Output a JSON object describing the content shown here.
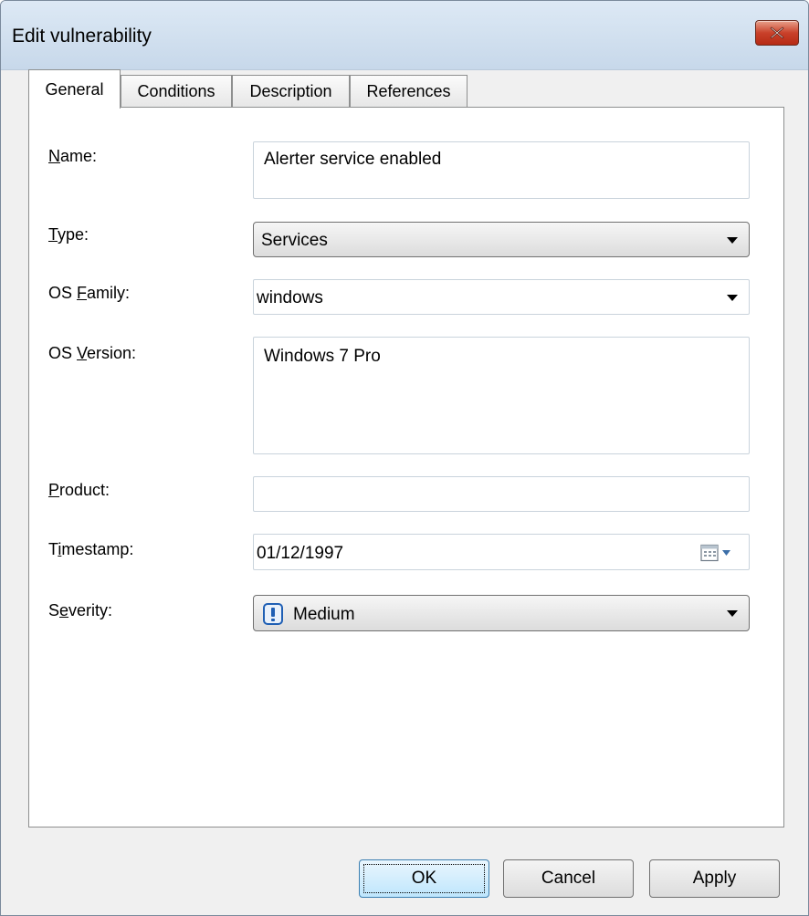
{
  "window": {
    "title": "Edit vulnerability"
  },
  "tabs": [
    {
      "label": "General",
      "active": true
    },
    {
      "label": "Conditions",
      "active": false
    },
    {
      "label": "Description",
      "active": false
    },
    {
      "label": "References",
      "active": false
    }
  ],
  "form": {
    "name": {
      "label_pre": "",
      "label_u": "N",
      "label_post": "ame:",
      "value": "Alerter service enabled"
    },
    "type": {
      "label_pre": "",
      "label_u": "T",
      "label_post": "ype:",
      "value": "Services"
    },
    "os_family": {
      "label_pre": "OS ",
      "label_u": "F",
      "label_post": "amily:",
      "value": "windows"
    },
    "os_version": {
      "label_pre": "OS ",
      "label_u": "V",
      "label_post": "ersion:",
      "value": "Windows 7 Pro"
    },
    "product": {
      "label_pre": "",
      "label_u": "P",
      "label_post": "roduct:",
      "value": ""
    },
    "timestamp": {
      "label_pre": "T",
      "label_u": "i",
      "label_post": "mestamp:",
      "value": "01/12/1997"
    },
    "severity": {
      "label_pre": "S",
      "label_u": "e",
      "label_post": "verity:",
      "value": "Medium",
      "icon": "exclamation-icon"
    }
  },
  "buttons": {
    "ok": "OK",
    "cancel": "Cancel",
    "apply": "Apply"
  },
  "colors": {
    "titlebar": "#c7d8ea",
    "close": "#c9412a",
    "severity_icon": "#1f5fb4"
  }
}
